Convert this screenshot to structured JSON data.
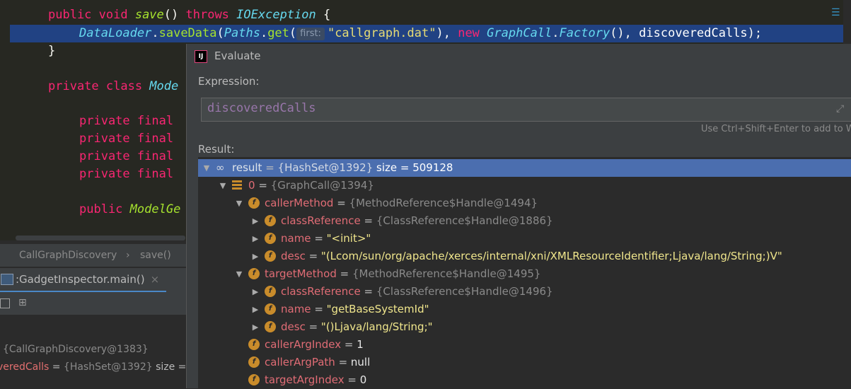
{
  "editor": {
    "line1": {
      "kw": "public void ",
      "fn": "save",
      "paren": "() ",
      "throws": "throws ",
      "ty": "IOException",
      "brace": " {"
    },
    "line2": {
      "cls": "DataLoader",
      "dot1": ".",
      "m1": "saveData",
      "p1": "(",
      "cls2": "Paths",
      "dot2": ".",
      "m2": "get",
      "p2": "(",
      "hint": "first:",
      "str": "\"callgraph.dat\"",
      "p3": "), ",
      "kw": "new ",
      "cls3": "GraphCall",
      "dot3": ".",
      "cls4": "Factory",
      "p4": "(), ",
      "arg": "discoveredCalls",
      "p5": ");"
    },
    "line3": "}",
    "line4": {
      "kw": "private class ",
      "ty": "Mode"
    },
    "field_kw": "private final",
    "line9": {
      "kw": "public ",
      "fn": "ModelGe"
    }
  },
  "breadcrumb": {
    "class": "CallGraphDiscovery",
    "sep": "›",
    "method": "save()"
  },
  "debug_tab": {
    "label": ":GadgetInspector.main()",
    "close": "×"
  },
  "toolbar": {
    "tool2": "⊞"
  },
  "variables": {
    "v1": "{CallGraphDiscovery@1383}",
    "v2_name": "veredCalls",
    "v2_eq": " = ",
    "v2_val": "{HashSet@1392}",
    "v2_size": " size = "
  },
  "dialog": {
    "title": "Evaluate",
    "expression_label": "Expression:",
    "expression": "discoveredCalls",
    "hint": "Use Ctrl+Shift+Enter to add to Wa",
    "result_label": "Result:"
  },
  "tree": [
    {
      "expanded": true,
      "icon": "infinity",
      "name": "result",
      "eq": " = ",
      "ref": "{HashSet@1392}",
      "extra": "  size = 509128",
      "value": "",
      "selected": true
    },
    {
      "expanded": true,
      "icon": "array",
      "name": "0",
      "eq": " = ",
      "ref": "{GraphCall@1394}",
      "extra": "",
      "value": "",
      "selected": false
    },
    {
      "expanded": true,
      "icon": "f",
      "name": "callerMethod",
      "eq": " = ",
      "ref": "{MethodReference$Handle@1494}",
      "extra": "",
      "value": "",
      "selected": false
    },
    {
      "expanded": false,
      "icon": "f",
      "name": "classReference",
      "eq": " = ",
      "ref": "{ClassReference$Handle@1886}",
      "extra": "",
      "value": "",
      "selected": false
    },
    {
      "expanded": false,
      "icon": "f",
      "name": "name",
      "eq": " = ",
      "ref": "",
      "extra": "",
      "value": "\"<init>\"",
      "selected": false
    },
    {
      "expanded": false,
      "icon": "f",
      "name": "desc",
      "eq": " = ",
      "ref": "",
      "extra": "",
      "value": "\"(Lcom/sun/org/apache/xerces/internal/xni/XMLResourceIdentifier;Ljava/lang/String;)V\"",
      "selected": false
    },
    {
      "expanded": true,
      "icon": "f",
      "name": "targetMethod",
      "eq": " = ",
      "ref": "{MethodReference$Handle@1495}",
      "extra": "",
      "value": "",
      "selected": false
    },
    {
      "expanded": false,
      "icon": "f",
      "name": "classReference",
      "eq": " = ",
      "ref": "{ClassReference$Handle@1496}",
      "extra": "",
      "value": "",
      "selected": false
    },
    {
      "expanded": false,
      "icon": "f",
      "name": "name",
      "eq": " = ",
      "ref": "",
      "extra": "",
      "value": "\"getBaseSystemId\"",
      "selected": false
    },
    {
      "expanded": false,
      "icon": "f",
      "name": "desc",
      "eq": " = ",
      "ref": "",
      "extra": "",
      "value": "\"()Ljava/lang/String;\"",
      "selected": false
    },
    {
      "expanded": null,
      "icon": "f",
      "name": "callerArgIndex",
      "eq": " = ",
      "ref": "",
      "extra": "",
      "value": "1",
      "selected": false
    },
    {
      "expanded": null,
      "icon": "f",
      "name": "callerArgPath",
      "eq": " = ",
      "ref": "",
      "extra": "",
      "value": "null",
      "selected": false
    },
    {
      "expanded": null,
      "icon": "f",
      "name": "targetArgIndex",
      "eq": " = ",
      "ref": "",
      "extra": "",
      "value": "0",
      "selected": false
    }
  ]
}
